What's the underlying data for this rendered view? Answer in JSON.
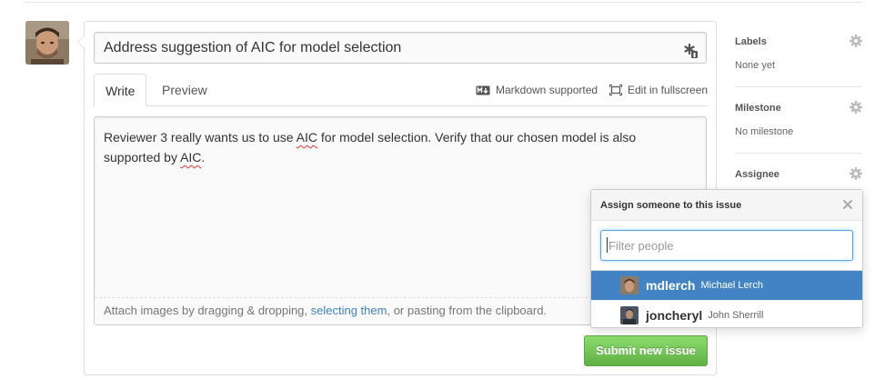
{
  "composer": {
    "title_value": "Address suggestion of AIC for model selection",
    "tabs": [
      {
        "label": "Write",
        "active": true
      },
      {
        "label": "Preview",
        "active": false
      }
    ],
    "markdown_label": "Markdown supported",
    "fullscreen_label": "Edit in fullscreen",
    "body": {
      "part1": "Reviewer 3 really wants us to use ",
      "aic1": "AIC",
      "part2": " for model selection.  Verify that our chosen model is also supported by ",
      "aic2": "AIC",
      "part3": "."
    },
    "drop_hint": {
      "before": "Attach images by dragging & dropping, ",
      "link": "selecting them",
      "after": ", or pasting from the clipboard."
    },
    "submit_label": "Submit new issue"
  },
  "sidebar": {
    "labels": {
      "heading": "Labels",
      "value": "None yet"
    },
    "milestone": {
      "heading": "Milestone",
      "value": "No milestone"
    },
    "assignee": {
      "heading": "Assignee"
    }
  },
  "assignee_popup": {
    "title": "Assign someone to this issue",
    "filter_placeholder": "Filter people",
    "filter_value": "",
    "users": [
      {
        "login": "mdlerch",
        "name": "Michael Lerch",
        "selected": true
      },
      {
        "login": "joncheryl",
        "name": "John Sherrill",
        "selected": false
      }
    ]
  },
  "colors": {
    "accent_blue": "#4183c4",
    "submit_green": "#60b044",
    "focus_blue": "#51a7e8"
  },
  "icons": {
    "title_field": "asterisk-icon",
    "markdown": "markdown-icon",
    "fullscreen": "fullscreen-icon",
    "sidebar": "gear-icon",
    "popup_close": "close-icon"
  }
}
